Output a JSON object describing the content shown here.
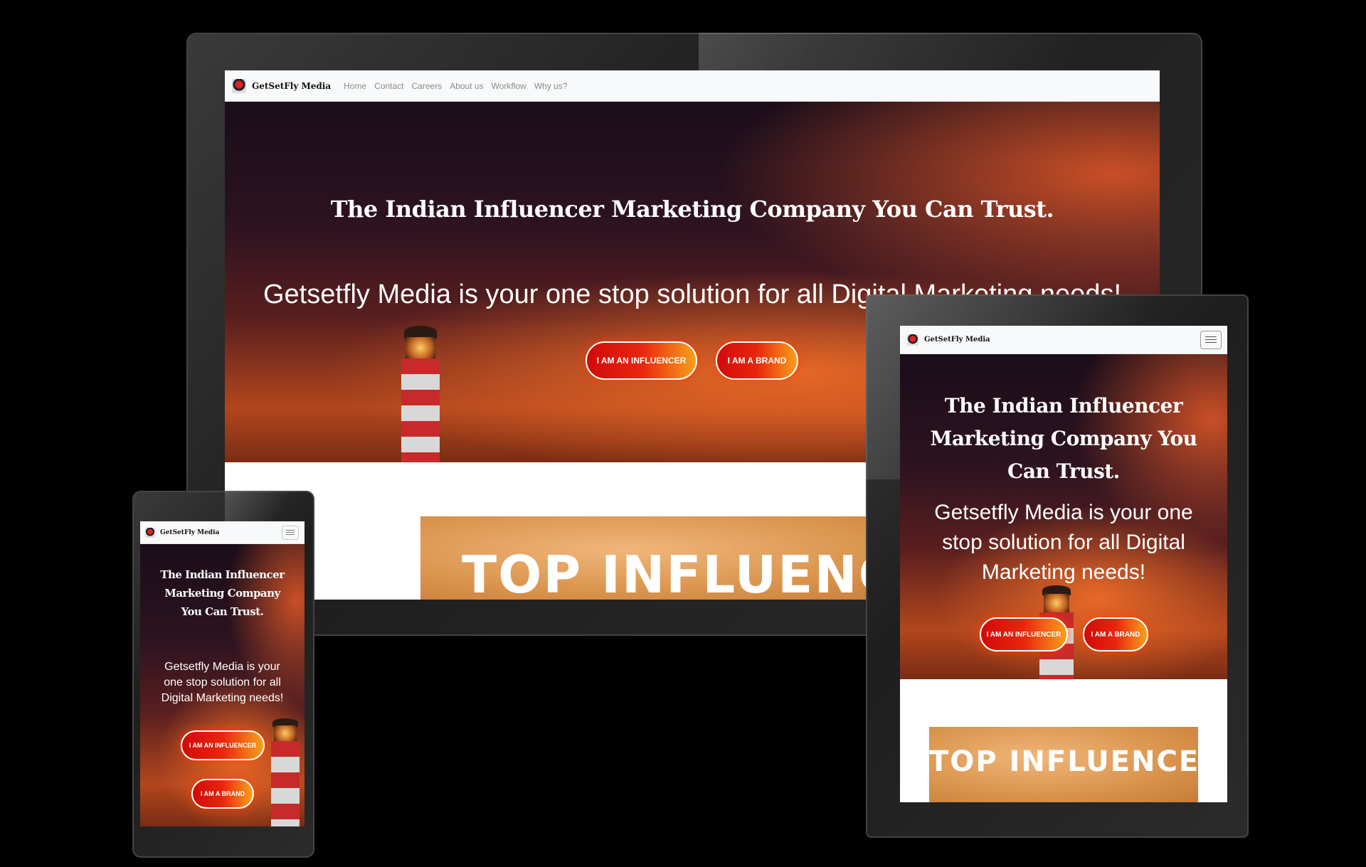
{
  "brand": {
    "name": "GetSetFly Media"
  },
  "nav": {
    "links": [
      "Home",
      "Contact",
      "Careers",
      "About us",
      "Workflow",
      "Why us?"
    ]
  },
  "hero": {
    "title": "The Indian Influencer Marketing Company You Can Trust.",
    "subtitle": "Getsetfly Media is your one stop solution for all Digital Marketing needs!",
    "button_influencer": "I AM AN INFLUENCER",
    "button_brand": "I AM A BRAND"
  },
  "section": {
    "banner_text": "TOP INFLUENCERS"
  },
  "colors": {
    "button_gradient_start": "#d10a0a",
    "button_gradient_end": "#f8a01c",
    "navbar_bg": "#f8f9fa",
    "banner_bg": "#d9934c"
  },
  "icons": [
    "brand-logo-icon",
    "hamburger-menu-icon"
  ]
}
